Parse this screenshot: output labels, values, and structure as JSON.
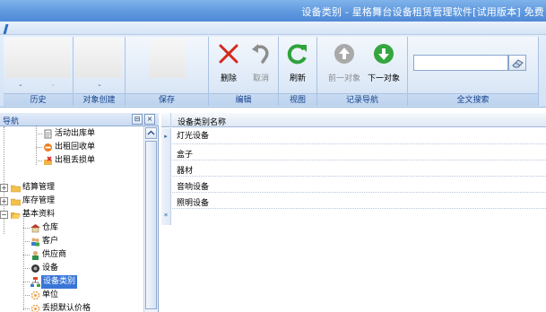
{
  "window": {
    "title": "设备类别 - 星格舞台设备租赁管理软件[试用版本] 免费"
  },
  "ribbon": {
    "groups": [
      {
        "label": "历史"
      },
      {
        "label": "对象创建"
      },
      {
        "label": "保存"
      },
      {
        "label": "编辑"
      },
      {
        "label": "视图"
      },
      {
        "label": "记录导航"
      },
      {
        "label": "全文搜索"
      }
    ],
    "buttons": {
      "delete": "删除",
      "cancel": "取消",
      "refresh": "刷新",
      "prev": "前一对象",
      "next": "下一对象"
    },
    "search": {
      "value": ""
    }
  },
  "nav": {
    "title": "导航",
    "pin": "⊟",
    "close": "×",
    "items": [
      {
        "label": "活动出库单",
        "icon": "document-icon"
      },
      {
        "label": "出租回收单",
        "icon": "return-icon"
      },
      {
        "label": "出租丢损单",
        "icon": "damage-icon"
      },
      {
        "label": "结算管理",
        "icon": "folder-icon"
      },
      {
        "label": "库存管理",
        "icon": "folder-icon"
      },
      {
        "label": "基本资料",
        "icon": "folder-open-icon"
      },
      {
        "label": "仓库",
        "icon": "warehouse-icon"
      },
      {
        "label": "客户",
        "icon": "customers-icon"
      },
      {
        "label": "供应商",
        "icon": "supplier-icon"
      },
      {
        "label": "设备",
        "icon": "equipment-icon"
      },
      {
        "label": "设备类别",
        "icon": "category-icon"
      },
      {
        "label": "单位",
        "icon": "unit-icon"
      },
      {
        "label": "丢损默认价格",
        "icon": "price-icon"
      }
    ],
    "expanders": {
      "plus": "+",
      "minus": "−"
    }
  },
  "grid": {
    "column": "设备类别名称",
    "rows": [
      "灯光设备",
      "盒子",
      "器材",
      "音响设备",
      "照明设备"
    ],
    "current_marker": "▸",
    "new_marker": "*"
  }
}
